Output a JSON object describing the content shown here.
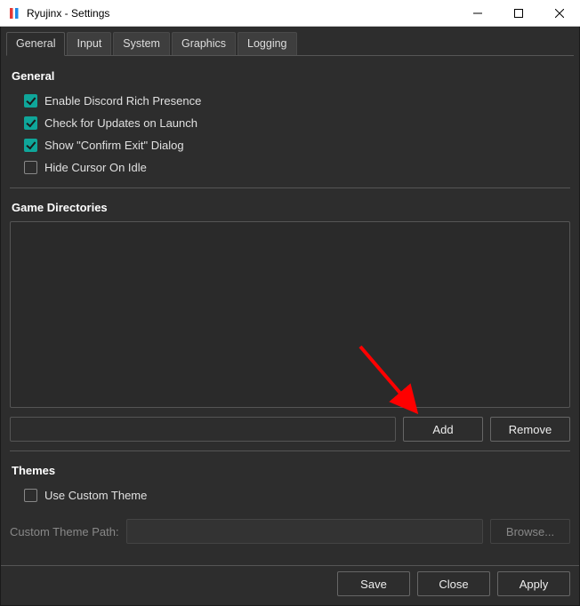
{
  "window": {
    "title": "Ryujinx - Settings"
  },
  "tabs": [
    {
      "label": "General",
      "active": true
    },
    {
      "label": "Input",
      "active": false
    },
    {
      "label": "System",
      "active": false
    },
    {
      "label": "Graphics",
      "active": false
    },
    {
      "label": "Logging",
      "active": false
    }
  ],
  "general": {
    "heading": "General",
    "options": {
      "discord": {
        "label": "Enable Discord Rich Presence",
        "checked": true
      },
      "updates": {
        "label": "Check for Updates on Launch",
        "checked": true
      },
      "confirmExit": {
        "label": "Show \"Confirm Exit\" Dialog",
        "checked": true
      },
      "hideCursor": {
        "label": "Hide Cursor On Idle",
        "checked": false
      }
    }
  },
  "gameDirs": {
    "heading": "Game Directories",
    "pathValue": "",
    "addLabel": "Add",
    "removeLabel": "Remove"
  },
  "themes": {
    "heading": "Themes",
    "useCustom": {
      "label": "Use Custom Theme",
      "checked": false
    },
    "pathLabel": "Custom Theme Path:",
    "pathValue": "",
    "browseLabel": "Browse..."
  },
  "footer": {
    "save": "Save",
    "close": "Close",
    "apply": "Apply"
  }
}
